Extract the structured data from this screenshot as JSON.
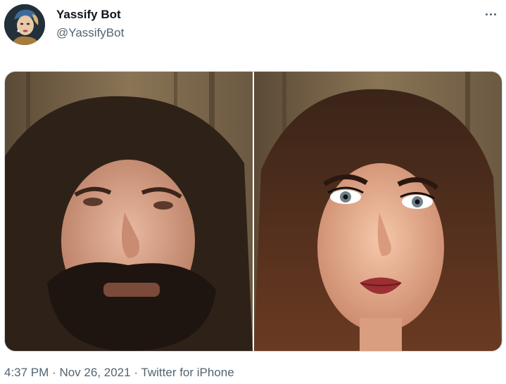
{
  "tweet": {
    "display_name": "Yassify Bot",
    "handle": "@YassifyBot",
    "time": "4:37 PM",
    "separator": "·",
    "date": "Nov 26, 2021",
    "source": "Twitter for iPhone"
  },
  "icons": {
    "more": "more-options-icon"
  },
  "media": {
    "images": [
      {
        "name": "original-photo"
      },
      {
        "name": "yassified-photo"
      }
    ]
  },
  "colors": {
    "text_primary": "#0f1419",
    "text_secondary": "#536471",
    "border": "#cfd9de"
  }
}
